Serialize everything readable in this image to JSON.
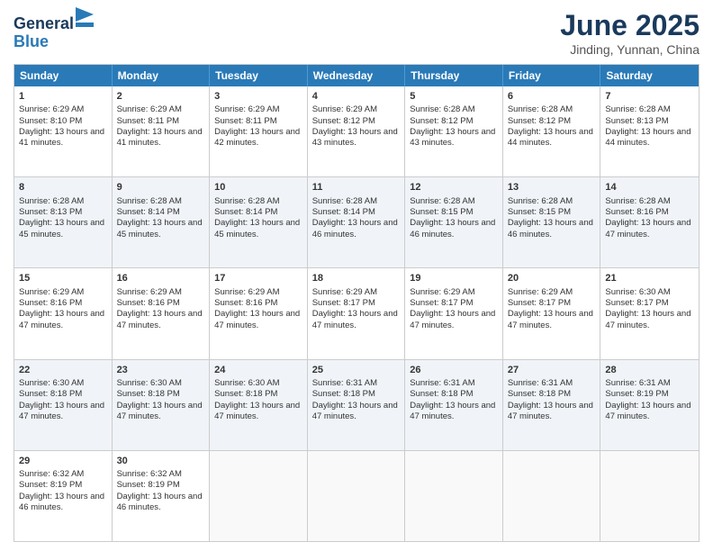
{
  "logo": {
    "general": "General",
    "blue": "Blue"
  },
  "header": {
    "title": "June 2025",
    "subtitle": "Jinding, Yunnan, China"
  },
  "calendar": {
    "days": [
      "Sunday",
      "Monday",
      "Tuesday",
      "Wednesday",
      "Thursday",
      "Friday",
      "Saturday"
    ],
    "rows": [
      [
        {
          "day": "1",
          "sunrise": "Sunrise: 6:29 AM",
          "sunset": "Sunset: 8:10 PM",
          "daylight": "Daylight: 13 hours and 41 minutes."
        },
        {
          "day": "2",
          "sunrise": "Sunrise: 6:29 AM",
          "sunset": "Sunset: 8:11 PM",
          "daylight": "Daylight: 13 hours and 41 minutes."
        },
        {
          "day": "3",
          "sunrise": "Sunrise: 6:29 AM",
          "sunset": "Sunset: 8:11 PM",
          "daylight": "Daylight: 13 hours and 42 minutes."
        },
        {
          "day": "4",
          "sunrise": "Sunrise: 6:29 AM",
          "sunset": "Sunset: 8:12 PM",
          "daylight": "Daylight: 13 hours and 43 minutes."
        },
        {
          "day": "5",
          "sunrise": "Sunrise: 6:28 AM",
          "sunset": "Sunset: 8:12 PM",
          "daylight": "Daylight: 13 hours and 43 minutes."
        },
        {
          "day": "6",
          "sunrise": "Sunrise: 6:28 AM",
          "sunset": "Sunset: 8:12 PM",
          "daylight": "Daylight: 13 hours and 44 minutes."
        },
        {
          "day": "7",
          "sunrise": "Sunrise: 6:28 AM",
          "sunset": "Sunset: 8:13 PM",
          "daylight": "Daylight: 13 hours and 44 minutes."
        }
      ],
      [
        {
          "day": "8",
          "sunrise": "Sunrise: 6:28 AM",
          "sunset": "Sunset: 8:13 PM",
          "daylight": "Daylight: 13 hours and 45 minutes."
        },
        {
          "day": "9",
          "sunrise": "Sunrise: 6:28 AM",
          "sunset": "Sunset: 8:14 PM",
          "daylight": "Daylight: 13 hours and 45 minutes."
        },
        {
          "day": "10",
          "sunrise": "Sunrise: 6:28 AM",
          "sunset": "Sunset: 8:14 PM",
          "daylight": "Daylight: 13 hours and 45 minutes."
        },
        {
          "day": "11",
          "sunrise": "Sunrise: 6:28 AM",
          "sunset": "Sunset: 8:14 PM",
          "daylight": "Daylight: 13 hours and 46 minutes."
        },
        {
          "day": "12",
          "sunrise": "Sunrise: 6:28 AM",
          "sunset": "Sunset: 8:15 PM",
          "daylight": "Daylight: 13 hours and 46 minutes."
        },
        {
          "day": "13",
          "sunrise": "Sunrise: 6:28 AM",
          "sunset": "Sunset: 8:15 PM",
          "daylight": "Daylight: 13 hours and 46 minutes."
        },
        {
          "day": "14",
          "sunrise": "Sunrise: 6:28 AM",
          "sunset": "Sunset: 8:16 PM",
          "daylight": "Daylight: 13 hours and 47 minutes."
        }
      ],
      [
        {
          "day": "15",
          "sunrise": "Sunrise: 6:29 AM",
          "sunset": "Sunset: 8:16 PM",
          "daylight": "Daylight: 13 hours and 47 minutes."
        },
        {
          "day": "16",
          "sunrise": "Sunrise: 6:29 AM",
          "sunset": "Sunset: 8:16 PM",
          "daylight": "Daylight: 13 hours and 47 minutes."
        },
        {
          "day": "17",
          "sunrise": "Sunrise: 6:29 AM",
          "sunset": "Sunset: 8:16 PM",
          "daylight": "Daylight: 13 hours and 47 minutes."
        },
        {
          "day": "18",
          "sunrise": "Sunrise: 6:29 AM",
          "sunset": "Sunset: 8:17 PM",
          "daylight": "Daylight: 13 hours and 47 minutes."
        },
        {
          "day": "19",
          "sunrise": "Sunrise: 6:29 AM",
          "sunset": "Sunset: 8:17 PM",
          "daylight": "Daylight: 13 hours and 47 minutes."
        },
        {
          "day": "20",
          "sunrise": "Sunrise: 6:29 AM",
          "sunset": "Sunset: 8:17 PM",
          "daylight": "Daylight: 13 hours and 47 minutes."
        },
        {
          "day": "21",
          "sunrise": "Sunrise: 6:30 AM",
          "sunset": "Sunset: 8:17 PM",
          "daylight": "Daylight: 13 hours and 47 minutes."
        }
      ],
      [
        {
          "day": "22",
          "sunrise": "Sunrise: 6:30 AM",
          "sunset": "Sunset: 8:18 PM",
          "daylight": "Daylight: 13 hours and 47 minutes."
        },
        {
          "day": "23",
          "sunrise": "Sunrise: 6:30 AM",
          "sunset": "Sunset: 8:18 PM",
          "daylight": "Daylight: 13 hours and 47 minutes."
        },
        {
          "day": "24",
          "sunrise": "Sunrise: 6:30 AM",
          "sunset": "Sunset: 8:18 PM",
          "daylight": "Daylight: 13 hours and 47 minutes."
        },
        {
          "day": "25",
          "sunrise": "Sunrise: 6:31 AM",
          "sunset": "Sunset: 8:18 PM",
          "daylight": "Daylight: 13 hours and 47 minutes."
        },
        {
          "day": "26",
          "sunrise": "Sunrise: 6:31 AM",
          "sunset": "Sunset: 8:18 PM",
          "daylight": "Daylight: 13 hours and 47 minutes."
        },
        {
          "day": "27",
          "sunrise": "Sunrise: 6:31 AM",
          "sunset": "Sunset: 8:18 PM",
          "daylight": "Daylight: 13 hours and 47 minutes."
        },
        {
          "day": "28",
          "sunrise": "Sunrise: 6:31 AM",
          "sunset": "Sunset: 8:19 PM",
          "daylight": "Daylight: 13 hours and 47 minutes."
        }
      ],
      [
        {
          "day": "29",
          "sunrise": "Sunrise: 6:32 AM",
          "sunset": "Sunset: 8:19 PM",
          "daylight": "Daylight: 13 hours and 46 minutes."
        },
        {
          "day": "30",
          "sunrise": "Sunrise: 6:32 AM",
          "sunset": "Sunset: 8:19 PM",
          "daylight": "Daylight: 13 hours and 46 minutes."
        },
        {
          "day": "",
          "sunrise": "",
          "sunset": "",
          "daylight": ""
        },
        {
          "day": "",
          "sunrise": "",
          "sunset": "",
          "daylight": ""
        },
        {
          "day": "",
          "sunrise": "",
          "sunset": "",
          "daylight": ""
        },
        {
          "day": "",
          "sunrise": "",
          "sunset": "",
          "daylight": ""
        },
        {
          "day": "",
          "sunrise": "",
          "sunset": "",
          "daylight": ""
        }
      ]
    ]
  }
}
